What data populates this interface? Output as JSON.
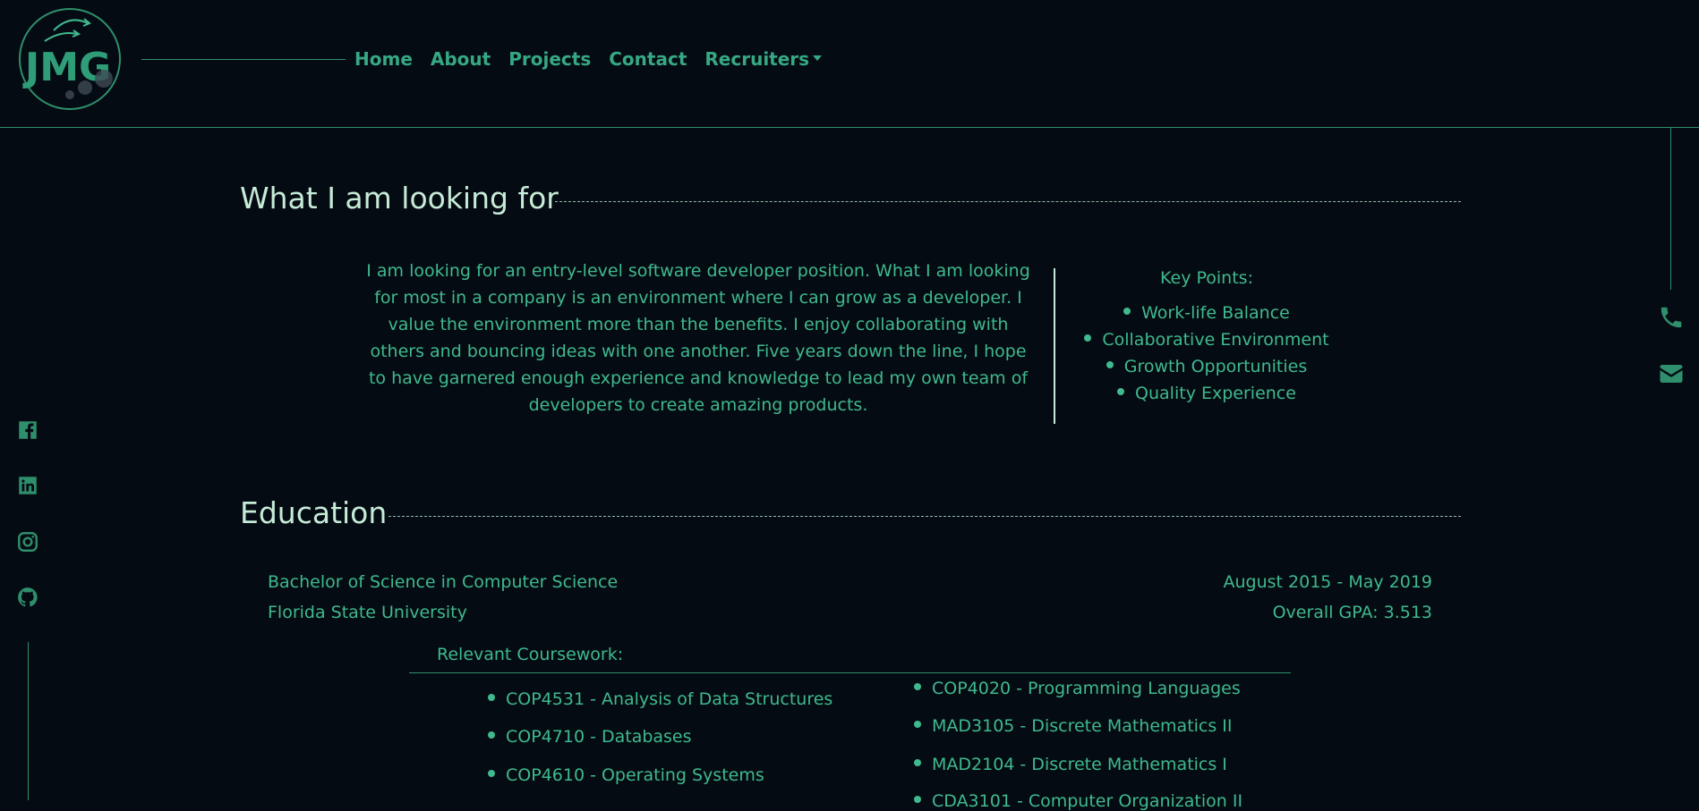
{
  "header": {
    "logo_text": "JMG",
    "nav": [
      {
        "label": "Home"
      },
      {
        "label": "About"
      },
      {
        "label": "Projects"
      },
      {
        "label": "Contact"
      },
      {
        "label": "Recruiters"
      }
    ]
  },
  "colors": {
    "background": "#050b12",
    "accent": "#3fb98e",
    "heading": "#c6ebd8"
  },
  "right_icons": [
    "phone-icon",
    "envelope-icon"
  ],
  "left_icons": [
    "facebook-icon",
    "linkedin-icon",
    "instagram-icon",
    "github-icon"
  ],
  "looking_for": {
    "title": "What I am looking for",
    "paragraph": "I am looking for an entry-level software developer position. What I am looking for most in a company is an environment where I can grow as a developer. I value the environment more than the benefits. I enjoy collaborating with others and bouncing ideas with one another. Five years down the line, I hope to have garnered enough experience and knowledge to lead my own team of developers to create amazing products.",
    "key_points_title": "Key Points:",
    "key_points": [
      "Work-life Balance",
      "Collaborative Environment",
      "Growth Opportunities",
      "Quality Experience"
    ]
  },
  "education": {
    "title": "Education",
    "degree": "Bachelor of Science in Computer Science",
    "school": "Florida State University",
    "dates": "August 2015 - May 2019",
    "gpa": "Overall GPA: 3.513",
    "coursework_label": "Relevant Coursework:",
    "courses_left": [
      "COP4531 - Analysis of Data Structures",
      "COP4710 - Databases",
      "COP4610 - Operating Systems"
    ],
    "courses_right": [
      "COP4020 - Programming Languages",
      "MAD3105 - Discrete Mathematics II",
      "MAD2104 - Discrete Mathematics I",
      "CDA3101 - Computer Organization II"
    ]
  }
}
